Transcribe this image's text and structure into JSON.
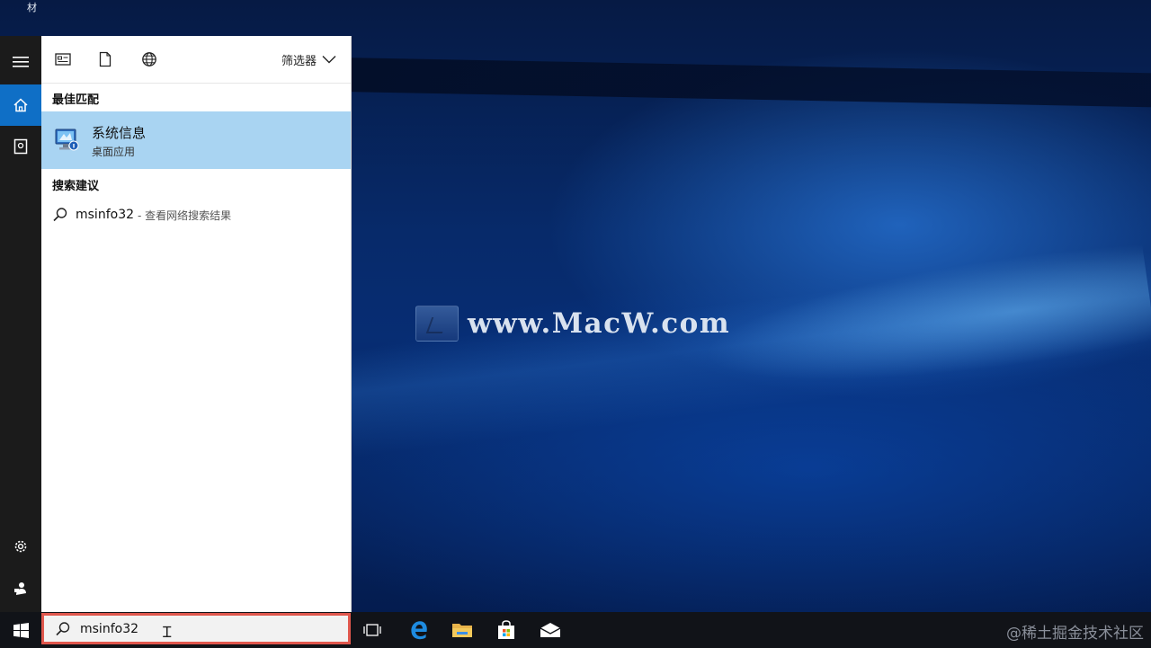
{
  "desktop": {
    "corner_label": "材",
    "watermark": "www.MacW.com"
  },
  "rail": {
    "items": [
      {
        "name": "menu",
        "icon": "hamburger-icon"
      },
      {
        "name": "home",
        "icon": "home-icon",
        "active": true
      },
      {
        "name": "notebook",
        "icon": "notebook-icon"
      },
      {
        "name": "settings",
        "icon": "gear-icon"
      },
      {
        "name": "feedback",
        "icon": "feedback-icon"
      }
    ]
  },
  "search_panel": {
    "toolbar": {
      "icons": [
        "apps-icon",
        "document-icon",
        "web-icon"
      ],
      "filter_label": "筛选器"
    },
    "best_match_label": "最佳匹配",
    "best_match": {
      "name": "系统信息",
      "type": "桌面应用"
    },
    "suggestions_label": "搜索建议",
    "suggestions": [
      {
        "query": "msinfo32",
        "hint": "- 查看网络搜索结果"
      }
    ]
  },
  "taskbar": {
    "search_value": "msinfo32",
    "apps": [
      "start-icon",
      "task-view-icon",
      "edge-icon",
      "file-explorer-icon",
      "store-icon",
      "mail-icon"
    ],
    "credit": "@稀土掘金技术社区"
  },
  "colors": {
    "accent": "#0f6fc6",
    "selection": "#a9d4f2",
    "highlight_border": "#e0574d"
  }
}
